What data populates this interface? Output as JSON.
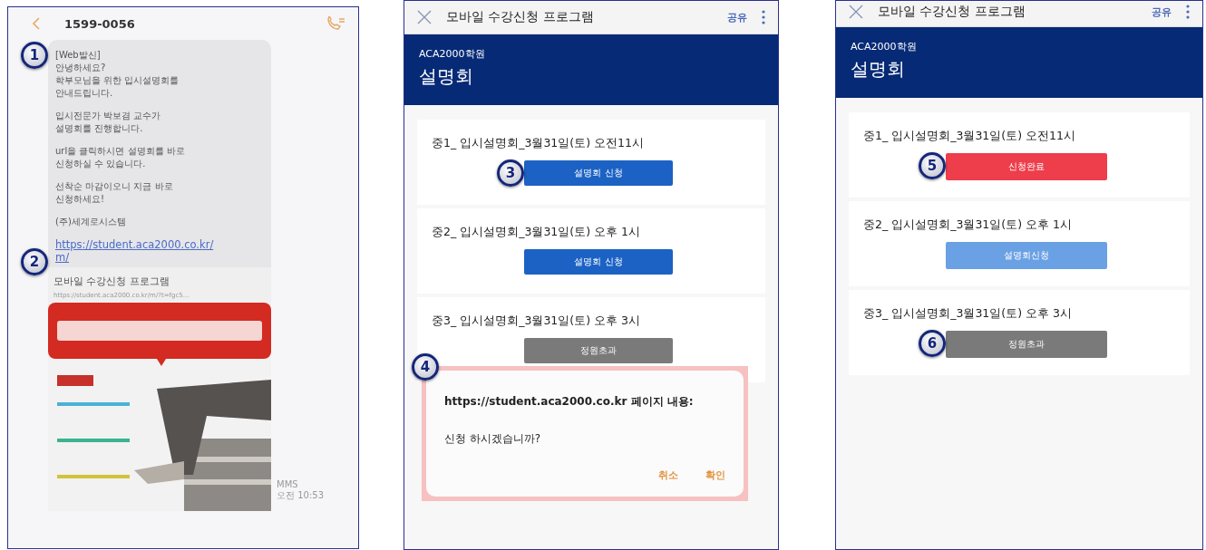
{
  "sms": {
    "sender": "1599-0056",
    "step": "1",
    "paragraphs": [
      "[Web발신]\n안녕하세요?\n학부모님을 위한 입시설명회를\n안내드립니다.",
      "입시전문가 박보겸 교수가\n설명회를 진행합니다.",
      "url을 클릭하시면 설명회를 바로\n신청하실 수 있습니다.",
      "선착순 마감이오니 지금 바로\n신청하세요!",
      "(주)세계로시스템"
    ],
    "link": "https://student.aca2000.co.kr/\nm/",
    "link_step": "2",
    "preview": {
      "title": "모바일 수강신청 프로그램",
      "url": "https://student.aca2000.co.kr/m/?t=fgc5..."
    },
    "type": "MMS",
    "time": "오전 10:53"
  },
  "app_screens": [
    {
      "title": "모바일 수강신청 프로그램",
      "share": "공유",
      "academy": "ACA2000학원",
      "heading": "설명회",
      "sessions": [
        {
          "title": "중1_ 입시설명회_3월31일(토) 오전11시",
          "button": {
            "label": "설명회 신청",
            "kind": "apply",
            "disabled": false
          },
          "step": "3"
        },
        {
          "title": "중2_ 입시설명회_3월31일(토) 오후 1시",
          "button": {
            "label": "설명회 신청",
            "kind": "apply",
            "disabled": false
          }
        },
        {
          "title": "중3_ 입시설명회_3월31일(토) 오후 3시",
          "button": {
            "label": "정원초과",
            "kind": "full",
            "disabled": false
          }
        }
      ],
      "dialog": {
        "step": "4",
        "title": "https://student.aca2000.co.kr 페이지 내용:",
        "message": "신청 하시겠습니까?",
        "buttons": [
          "취소",
          "확인"
        ]
      }
    },
    {
      "title": "모바일 수강신청 프로그램",
      "share": "공유",
      "academy": "ACA2000학원",
      "heading": "설명회",
      "sessions": [
        {
          "title": "중1_ 입시설명회_3월31일(토) 오전11시",
          "button": {
            "label": "신청완료",
            "kind": "applied",
            "disabled": false
          },
          "step": "5"
        },
        {
          "title": "중2_ 입시설명회_3월31일(토) 오후 1시",
          "button": {
            "label": "설명회신청",
            "kind": "apply",
            "disabled": true
          }
        },
        {
          "title": "중3_ 입시설명회_3월31일(토) 오후 3시",
          "button": {
            "label": "정원초과",
            "kind": "full",
            "disabled": false
          },
          "step": "6"
        }
      ]
    }
  ]
}
